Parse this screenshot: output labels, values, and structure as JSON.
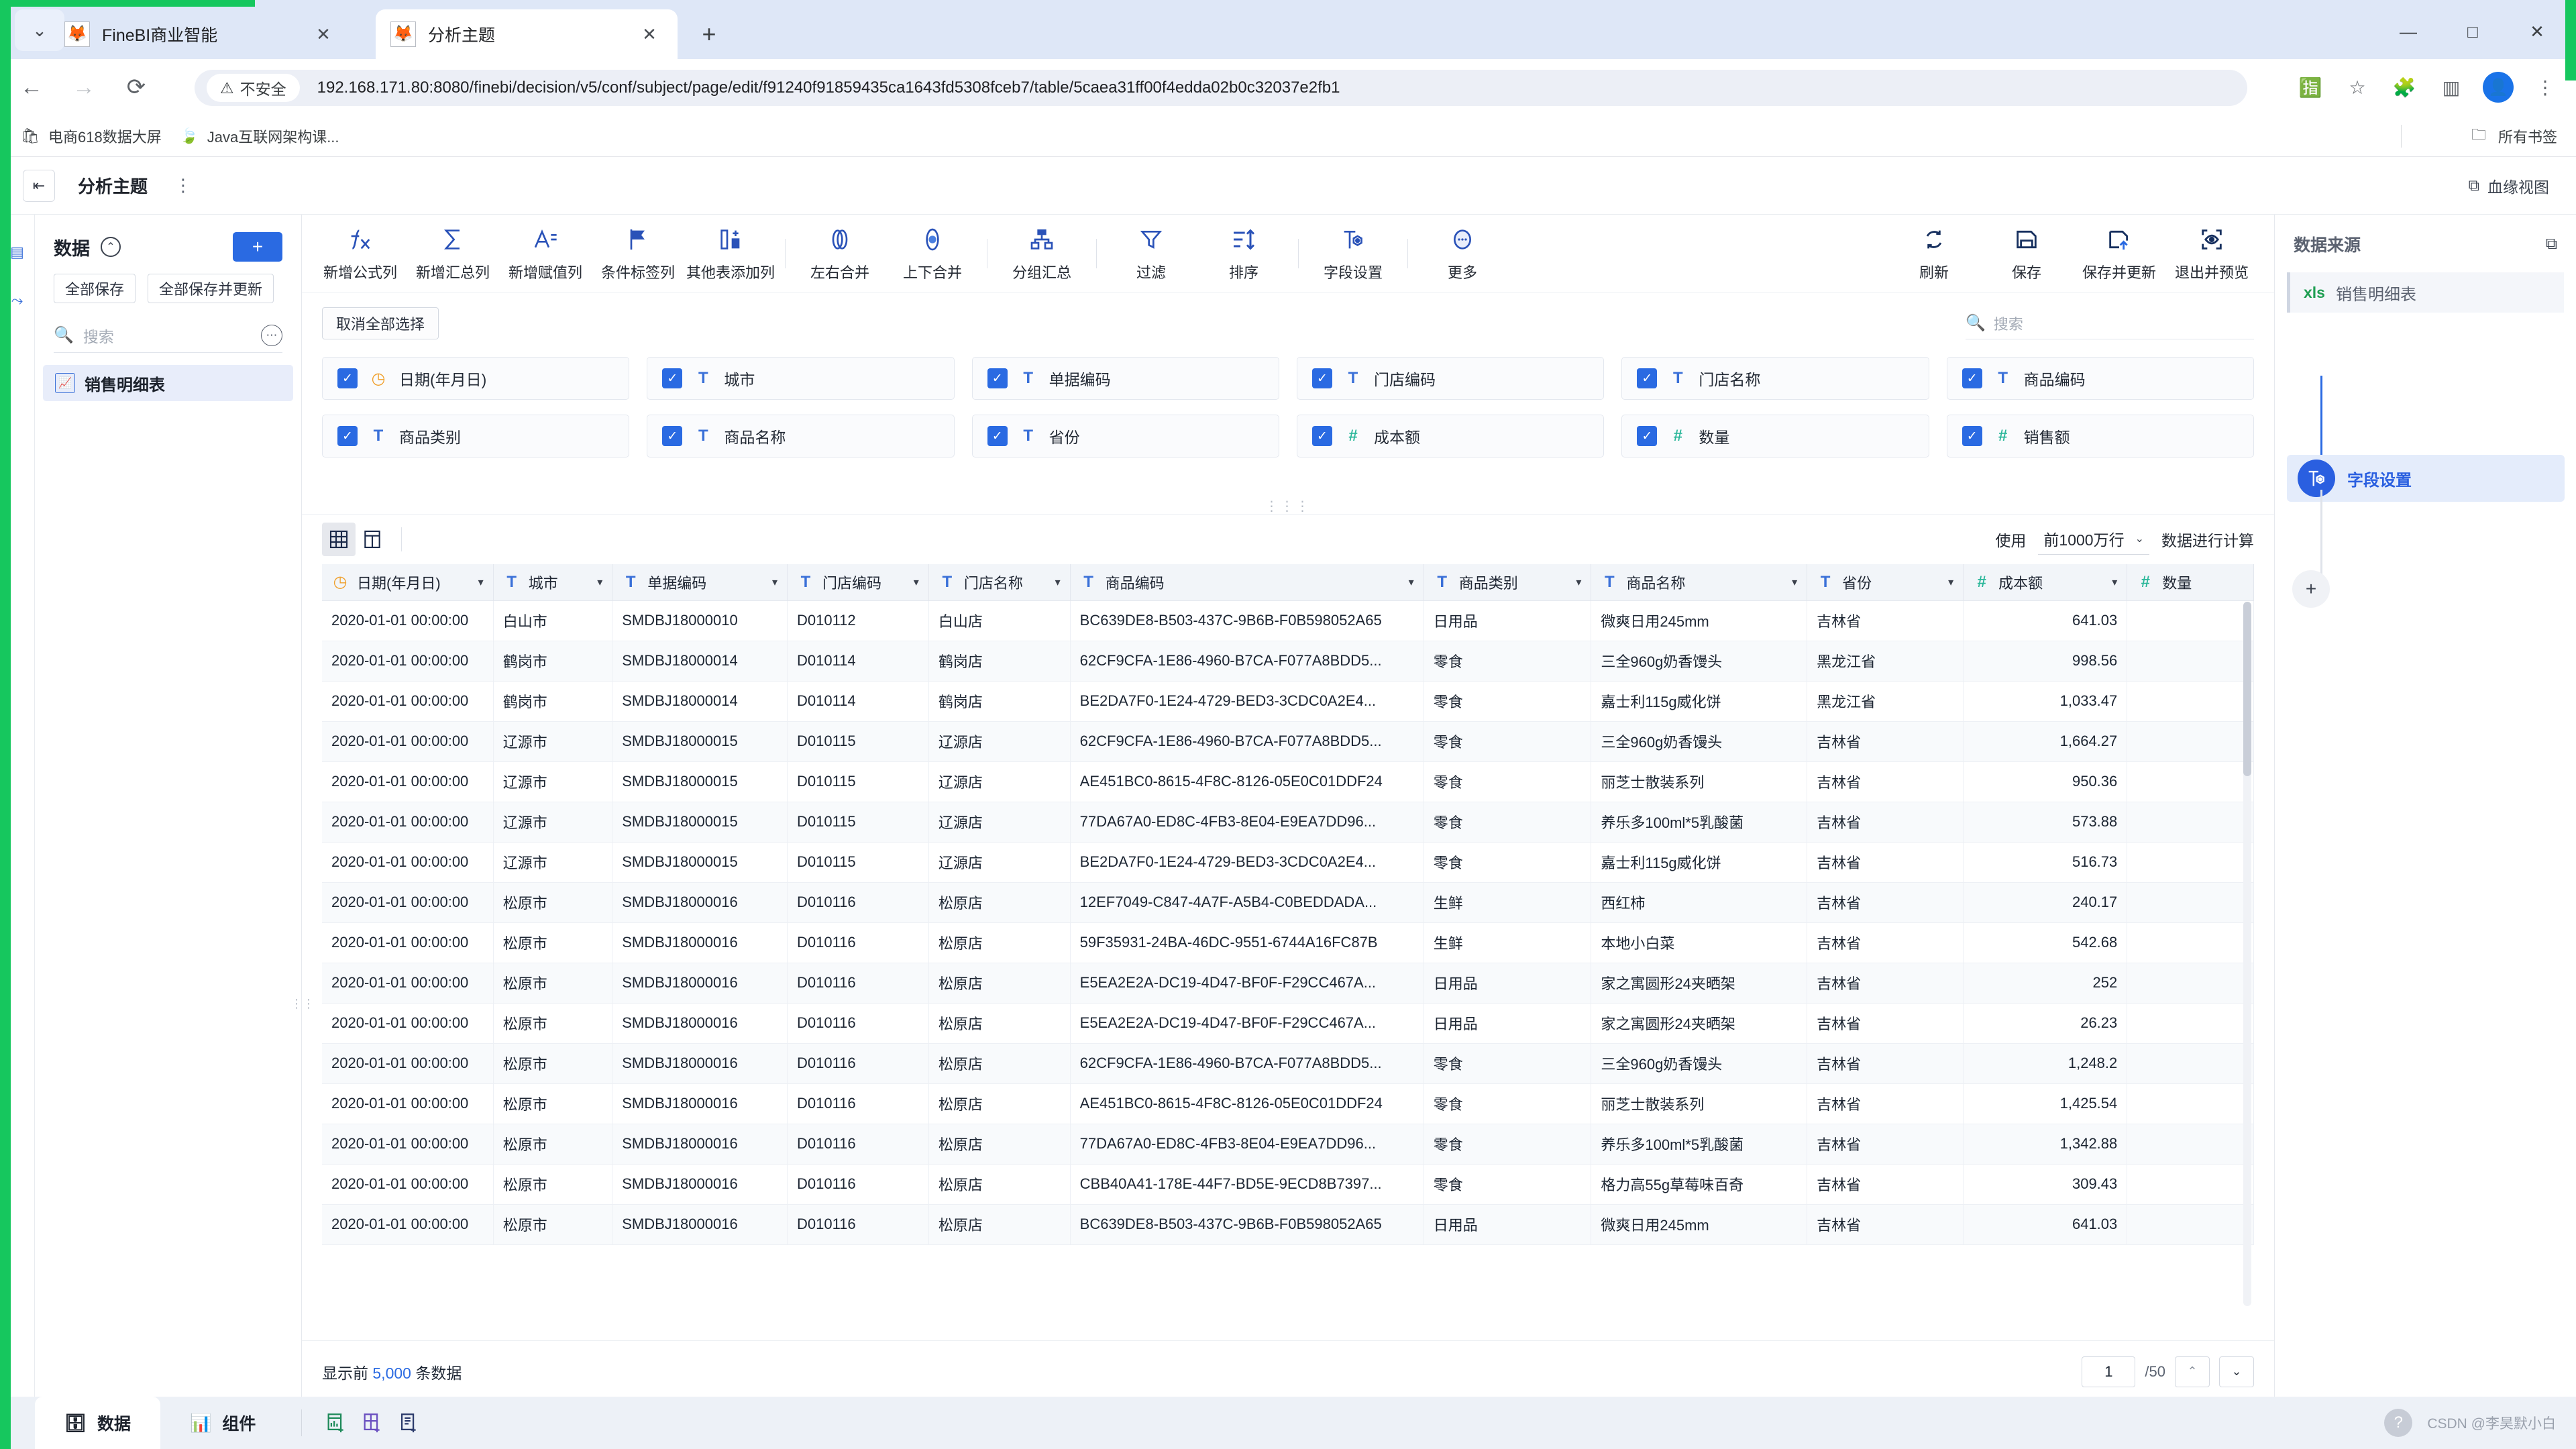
{
  "browser": {
    "tabs": [
      {
        "title": "FineBI商业智能",
        "active": false,
        "favicon": "finebi-favicon"
      },
      {
        "title": "分析主题",
        "active": true,
        "favicon": "finebi-favicon"
      }
    ],
    "new_tab_label": "+",
    "window_controls": {
      "minimize": "—",
      "maximize": "□",
      "close": "✕"
    },
    "nav": {
      "back": "←",
      "forward": "→",
      "reload": "⟳"
    },
    "security_label": "不安全",
    "url": "192.168.171.80:8080/finebi/decision/v5/conf/subject/page/edit/f91240f91859435ca1643fd5308fceb7/table/5caea31ff00f4edda02b0c32037e2fb1",
    "bookmarks": [
      {
        "label": "电商618数据大屏",
        "icon": "shop-icon"
      },
      {
        "label": "Java互联网架构课...",
        "icon": "leaf-icon"
      }
    ],
    "bookmarks_right": {
      "label": "所有书签",
      "icon": "folder-icon"
    }
  },
  "app_header": {
    "collapse_icon": "collapse-panel-icon",
    "title": "分析主题",
    "more_icon": "more-vertical-icon",
    "lineage_label": "血缘视图",
    "lineage_icon": "lineage-icon"
  },
  "rail": {
    "items": [
      {
        "icon": "table-rail-icon"
      },
      {
        "icon": "flow-rail-icon"
      }
    ]
  },
  "left_panel": {
    "title": "数据",
    "collapse_icon": "chevrons-up-icon",
    "add_label": "+",
    "buttons": [
      "全部保存",
      "全部保存并更新"
    ],
    "search_placeholder": "搜索",
    "search_icon": "search-icon",
    "more_icon": "more-horizontal-icon",
    "items": [
      {
        "label": "销售明细表",
        "icon": "table-chart-icon"
      }
    ]
  },
  "toolbar": {
    "groups": [
      {
        "items": [
          {
            "label": "新增公式列",
            "icon": "fx-icon"
          },
          {
            "label": "新增汇总列",
            "icon": "sigma-icon"
          },
          {
            "label": "新增赋值列",
            "icon": "assign-column-icon"
          },
          {
            "label": "条件标签列",
            "icon": "flag-icon"
          },
          {
            "label": "其他表添加列",
            "icon": "add-column-icon"
          }
        ]
      },
      {
        "items": [
          {
            "label": "左右合并",
            "icon": "merge-horizontal-icon"
          },
          {
            "label": "上下合并",
            "icon": "merge-vertical-icon"
          }
        ]
      },
      {
        "items": [
          {
            "label": "分组汇总",
            "icon": "group-summary-icon"
          }
        ]
      },
      {
        "items": [
          {
            "label": "过滤",
            "icon": "filter-icon"
          },
          {
            "label": "排序",
            "icon": "sort-icon"
          }
        ]
      },
      {
        "items": [
          {
            "label": "字段设置",
            "icon": "field-settings-icon"
          }
        ]
      },
      {
        "items": [
          {
            "label": "更多",
            "icon": "more-circle-icon"
          }
        ]
      }
    ],
    "right_items": [
      {
        "label": "刷新",
        "icon": "refresh-icon"
      },
      {
        "label": "保存",
        "icon": "save-icon"
      },
      {
        "label": "保存并更新",
        "icon": "save-update-icon"
      },
      {
        "label": "退出并预览",
        "icon": "preview-icon"
      }
    ]
  },
  "fields": {
    "deselect_all_label": "取消全部选择",
    "search_placeholder": "搜索",
    "search_icon": "search-icon",
    "chips": [
      {
        "label": "日期(年月日)",
        "type": "date",
        "checked": true
      },
      {
        "label": "城市",
        "type": "text",
        "checked": true
      },
      {
        "label": "单据编码",
        "type": "text",
        "checked": true
      },
      {
        "label": "门店编码",
        "type": "text",
        "checked": true
      },
      {
        "label": "门店名称",
        "type": "text",
        "checked": true
      },
      {
        "label": "商品编码",
        "type": "text",
        "checked": true
      },
      {
        "label": "商品类别",
        "type": "text",
        "checked": true
      },
      {
        "label": "商品名称",
        "type": "text",
        "checked": true
      },
      {
        "label": "省份",
        "type": "text",
        "checked": true
      },
      {
        "label": "成本额",
        "type": "number",
        "checked": true
      },
      {
        "label": "数量",
        "type": "number",
        "checked": true
      },
      {
        "label": "销售额",
        "type": "number",
        "checked": true
      }
    ]
  },
  "table_zone": {
    "view_buttons": [
      {
        "icon": "grid-view-icon",
        "active": true
      },
      {
        "icon": "column-view-icon",
        "active": false
      }
    ],
    "rows_prefix_label": "使用",
    "rows_select_value": "前1000万行",
    "rows_suffix_label": "数据进行计算",
    "dropdown_icon": "chevron-down-icon",
    "columns": [
      {
        "label": "日期(年月日)",
        "type": "date"
      },
      {
        "label": "城市",
        "type": "text"
      },
      {
        "label": "单据编码",
        "type": "text"
      },
      {
        "label": "门店编码",
        "type": "text"
      },
      {
        "label": "门店名称",
        "type": "text"
      },
      {
        "label": "商品编码",
        "type": "text"
      },
      {
        "label": "商品类别",
        "type": "text"
      },
      {
        "label": "商品名称",
        "type": "text"
      },
      {
        "label": "省份",
        "type": "text"
      },
      {
        "label": "成本额",
        "type": "number"
      },
      {
        "label": "数量",
        "type": "number"
      }
    ],
    "rows": [
      [
        "2020-01-01 00:00:00",
        "白山市",
        "SMDBJ18000010",
        "D010112",
        "白山店",
        "BC639DE8-B503-437C-9B6B-F0B598052A65",
        "日用品",
        "微爽日用245mm",
        "吉林省",
        "641.03",
        ""
      ],
      [
        "2020-01-01 00:00:00",
        "鹤岗市",
        "SMDBJ18000014",
        "D010114",
        "鹤岗店",
        "62CF9CFA-1E86-4960-B7CA-F077A8BDD5...",
        "零食",
        "三全960g奶香馒头",
        "黑龙江省",
        "998.56",
        ""
      ],
      [
        "2020-01-01 00:00:00",
        "鹤岗市",
        "SMDBJ18000014",
        "D010114",
        "鹤岗店",
        "BE2DA7F0-1E24-4729-BED3-3CDC0A2E4...",
        "零食",
        "嘉士利115g威化饼",
        "黑龙江省",
        "1,033.47",
        ""
      ],
      [
        "2020-01-01 00:00:00",
        "辽源市",
        "SMDBJ18000015",
        "D010115",
        "辽源店",
        "62CF9CFA-1E86-4960-B7CA-F077A8BDD5...",
        "零食",
        "三全960g奶香馒头",
        "吉林省",
        "1,664.27",
        ""
      ],
      [
        "2020-01-01 00:00:00",
        "辽源市",
        "SMDBJ18000015",
        "D010115",
        "辽源店",
        "AE451BC0-8615-4F8C-8126-05E0C01DDF24",
        "零食",
        "丽芝士散装系列",
        "吉林省",
        "950.36",
        ""
      ],
      [
        "2020-01-01 00:00:00",
        "辽源市",
        "SMDBJ18000015",
        "D010115",
        "辽源店",
        "77DA67A0-ED8C-4FB3-8E04-E9EA7DD96...",
        "零食",
        "养乐多100ml*5乳酸菌",
        "吉林省",
        "573.88",
        ""
      ],
      [
        "2020-01-01 00:00:00",
        "辽源市",
        "SMDBJ18000015",
        "D010115",
        "辽源店",
        "BE2DA7F0-1E24-4729-BED3-3CDC0A2E4...",
        "零食",
        "嘉士利115g威化饼",
        "吉林省",
        "516.73",
        ""
      ],
      [
        "2020-01-01 00:00:00",
        "松原市",
        "SMDBJ18000016",
        "D010116",
        "松原店",
        "12EF7049-C847-4A7F-A5B4-C0BEDDADA...",
        "生鲜",
        "西红柿",
        "吉林省",
        "240.17",
        ""
      ],
      [
        "2020-01-01 00:00:00",
        "松原市",
        "SMDBJ18000016",
        "D010116",
        "松原店",
        "59F35931-24BA-46DC-9551-6744A16FC87B",
        "生鲜",
        "本地小白菜",
        "吉林省",
        "542.68",
        ""
      ],
      [
        "2020-01-01 00:00:00",
        "松原市",
        "SMDBJ18000016",
        "D010116",
        "松原店",
        "E5EA2E2A-DC19-4D47-BF0F-F29CC467A...",
        "日用品",
        "家之寓圆形24夹晒架",
        "吉林省",
        "252",
        ""
      ],
      [
        "2020-01-01 00:00:00",
        "松原市",
        "SMDBJ18000016",
        "D010116",
        "松原店",
        "E5EA2E2A-DC19-4D47-BF0F-F29CC467A...",
        "日用品",
        "家之寓圆形24夹晒架",
        "吉林省",
        "26.23",
        ""
      ],
      [
        "2020-01-01 00:00:00",
        "松原市",
        "SMDBJ18000016",
        "D010116",
        "松原店",
        "62CF9CFA-1E86-4960-B7CA-F077A8BDD5...",
        "零食",
        "三全960g奶香馒头",
        "吉林省",
        "1,248.2",
        ""
      ],
      [
        "2020-01-01 00:00:00",
        "松原市",
        "SMDBJ18000016",
        "D010116",
        "松原店",
        "AE451BC0-8615-4F8C-8126-05E0C01DDF24",
        "零食",
        "丽芝士散装系列",
        "吉林省",
        "1,425.54",
        ""
      ],
      [
        "2020-01-01 00:00:00",
        "松原市",
        "SMDBJ18000016",
        "D010116",
        "松原店",
        "77DA67A0-ED8C-4FB3-8E04-E9EA7DD96...",
        "零食",
        "养乐多100ml*5乳酸菌",
        "吉林省",
        "1,342.88",
        ""
      ],
      [
        "2020-01-01 00:00:00",
        "松原市",
        "SMDBJ18000016",
        "D010116",
        "松原店",
        "CBB40A41-178E-44F7-BD5E-9ECD8B7397...",
        "零食",
        "格力高55g草莓味百奇",
        "吉林省",
        "309.43",
        ""
      ],
      [
        "2020-01-01 00:00:00",
        "松原市",
        "SMDBJ18000016",
        "D010116",
        "松原店",
        "BC639DE8-B503-437C-9B6B-F0B598052A65",
        "日用品",
        "微爽日用245mm",
        "吉林省",
        "641.03",
        ""
      ]
    ],
    "footer": {
      "note_prefix": "显示前 ",
      "note_count": "5,000",
      "note_suffix": " 条数据",
      "page_value": "1",
      "page_total": "/50",
      "prev_icon": "chevron-up-icon",
      "next_icon": "chevron-down-icon"
    }
  },
  "right_panel": {
    "title": "数据来源",
    "expand_icon": "expand-flow-icon",
    "source": {
      "badge": "xls",
      "label": "销售明细表"
    },
    "node": {
      "label": "字段设置",
      "icon": "field-settings-icon"
    },
    "add_icon": "plus-icon"
  },
  "bottom_bar": {
    "tabs": [
      {
        "label": "数据",
        "icon": "database-icon",
        "active": true
      },
      {
        "label": "组件",
        "icon": "chart-icon",
        "active": false
      }
    ],
    "actions": [
      {
        "icon": "add-chart-icon"
      },
      {
        "icon": "add-dashboard-icon"
      },
      {
        "icon": "add-doc-icon"
      }
    ],
    "help_icon": "help-icon",
    "watermark": "CSDN @李昊默小白"
  },
  "colors": {
    "accent": "#2a6ae2",
    "accent_dark": "#2a52b8",
    "green": "#16c75e",
    "number_type": "#2bb79a",
    "date_type": "#f0a02c"
  }
}
